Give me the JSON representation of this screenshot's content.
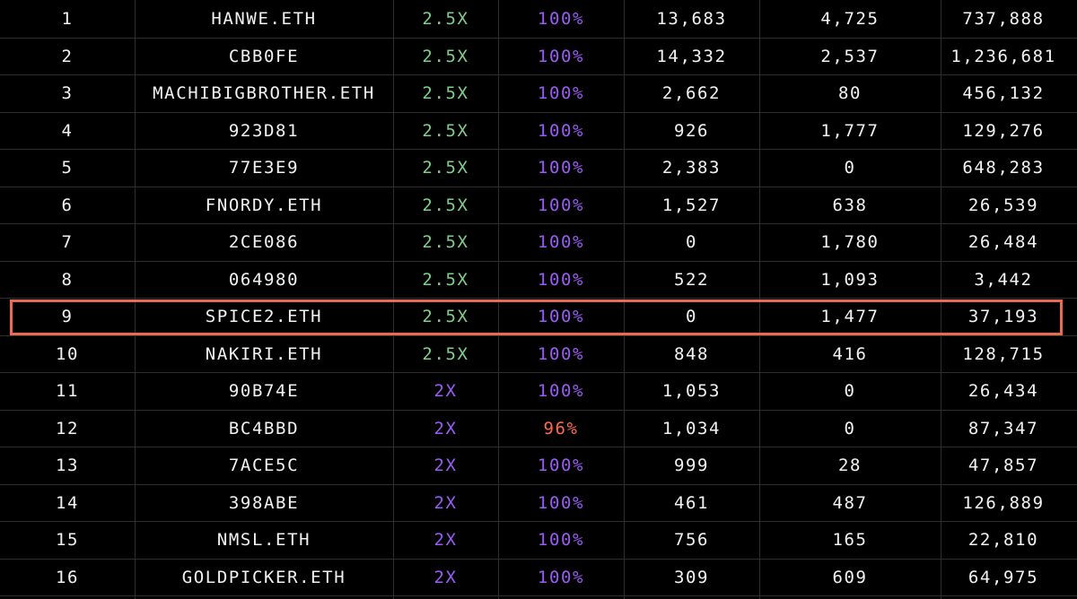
{
  "colors": {
    "background": "#000000",
    "grid_line": "#2f2f2f",
    "text": "#f2f2f2",
    "multiplier_2_5x": "#7fcf8a",
    "multiplier_2x": "#9b5cf6",
    "percent_full": "#9b5cf6",
    "percent_low": "#ff6a4d",
    "highlight_border": "#ea6a52"
  },
  "highlighted_rank": "9",
  "rows": [
    {
      "rank": "1",
      "name": "HANWE.ETH",
      "multiplier": "2.5X",
      "percent": "100%",
      "value1": "13,683",
      "value2": "4,725",
      "value3": "737,888"
    },
    {
      "rank": "2",
      "name": "CBB0FE",
      "multiplier": "2.5X",
      "percent": "100%",
      "value1": "14,332",
      "value2": "2,537",
      "value3": "1,236,681"
    },
    {
      "rank": "3",
      "name": "MACHIBIGBROTHER.ETH",
      "multiplier": "2.5X",
      "percent": "100%",
      "value1": "2,662",
      "value2": "80",
      "value3": "456,132"
    },
    {
      "rank": "4",
      "name": "923D81",
      "multiplier": "2.5X",
      "percent": "100%",
      "value1": "926",
      "value2": "1,777",
      "value3": "129,276"
    },
    {
      "rank": "5",
      "name": "77E3E9",
      "multiplier": "2.5X",
      "percent": "100%",
      "value1": "2,383",
      "value2": "0",
      "value3": "648,283"
    },
    {
      "rank": "6",
      "name": "FNORDY.ETH",
      "multiplier": "2.5X",
      "percent": "100%",
      "value1": "1,527",
      "value2": "638",
      "value3": "26,539"
    },
    {
      "rank": "7",
      "name": "2CE086",
      "multiplier": "2.5X",
      "percent": "100%",
      "value1": "0",
      "value2": "1,780",
      "value3": "26,484"
    },
    {
      "rank": "8",
      "name": "064980",
      "multiplier": "2.5X",
      "percent": "100%",
      "value1": "522",
      "value2": "1,093",
      "value3": "3,442"
    },
    {
      "rank": "9",
      "name": "SPICE2.ETH",
      "multiplier": "2.5X",
      "percent": "100%",
      "value1": "0",
      "value2": "1,477",
      "value3": "37,193"
    },
    {
      "rank": "10",
      "name": "NAKIRI.ETH",
      "multiplier": "2.5X",
      "percent": "100%",
      "value1": "848",
      "value2": "416",
      "value3": "128,715"
    },
    {
      "rank": "11",
      "name": "90B74E",
      "multiplier": "2X",
      "percent": "100%",
      "value1": "1,053",
      "value2": "0",
      "value3": "26,434"
    },
    {
      "rank": "12",
      "name": "BC4BBD",
      "multiplier": "2X",
      "percent": "96%",
      "value1": "1,034",
      "value2": "0",
      "value3": "87,347"
    },
    {
      "rank": "13",
      "name": "7ACE5C",
      "multiplier": "2X",
      "percent": "100%",
      "value1": "999",
      "value2": "28",
      "value3": "47,857"
    },
    {
      "rank": "14",
      "name": "398ABE",
      "multiplier": "2X",
      "percent": "100%",
      "value1": "461",
      "value2": "487",
      "value3": "126,889"
    },
    {
      "rank": "15",
      "name": "NMSL.ETH",
      "multiplier": "2X",
      "percent": "100%",
      "value1": "756",
      "value2": "165",
      "value3": "22,810"
    },
    {
      "rank": "16",
      "name": "GOLDPICKER.ETH",
      "multiplier": "2X",
      "percent": "100%",
      "value1": "309",
      "value2": "609",
      "value3": "64,975"
    }
  ]
}
